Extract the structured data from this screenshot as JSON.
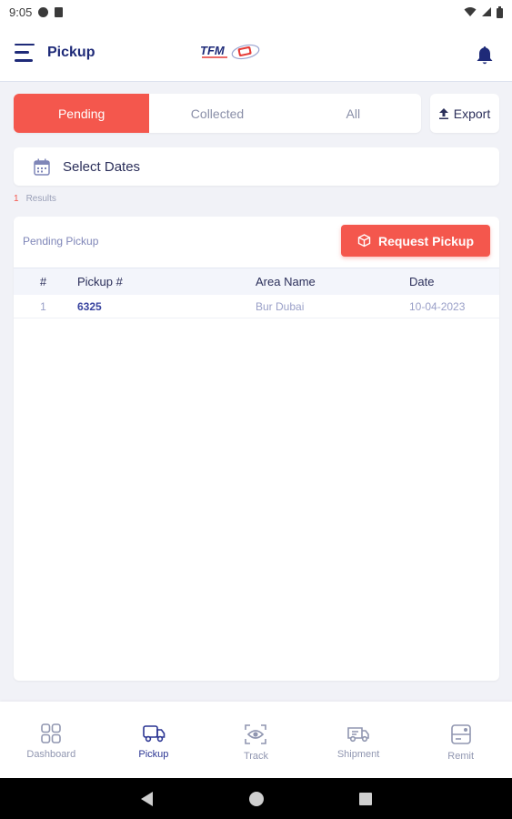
{
  "status_bar": {
    "time": "9:05"
  },
  "app_bar": {
    "title": "Pickup",
    "logo_text": "TFM"
  },
  "tabs": [
    {
      "label": "Pending",
      "active": true
    },
    {
      "label": "Collected",
      "active": false
    },
    {
      "label": "All",
      "active": false
    }
  ],
  "export_label": "Export",
  "date_filter": {
    "label": "Select Dates"
  },
  "results": {
    "count": "1",
    "label": "Results"
  },
  "card": {
    "title": "Pending Pickup",
    "request_button": "Request Pickup",
    "columns": [
      "#",
      "Pickup #",
      "Area Name",
      "Date"
    ],
    "rows": [
      {
        "index": "1",
        "pickup_no": "6325",
        "area": "Bur Dubai",
        "date": "10-04-2023"
      }
    ]
  },
  "bottom_nav": [
    {
      "label": "Dashboard",
      "icon": "grid-icon",
      "active": false
    },
    {
      "label": "Pickup",
      "icon": "truck-icon",
      "active": true
    },
    {
      "label": "Track",
      "icon": "eye-icon",
      "active": false
    },
    {
      "label": "Shipment",
      "icon": "van-icon",
      "active": false
    },
    {
      "label": "Remit",
      "icon": "receipt-icon",
      "active": false
    }
  ],
  "colors": {
    "accent": "#f4574d",
    "primary": "#1e2a78",
    "background": "#f1f2f7"
  }
}
